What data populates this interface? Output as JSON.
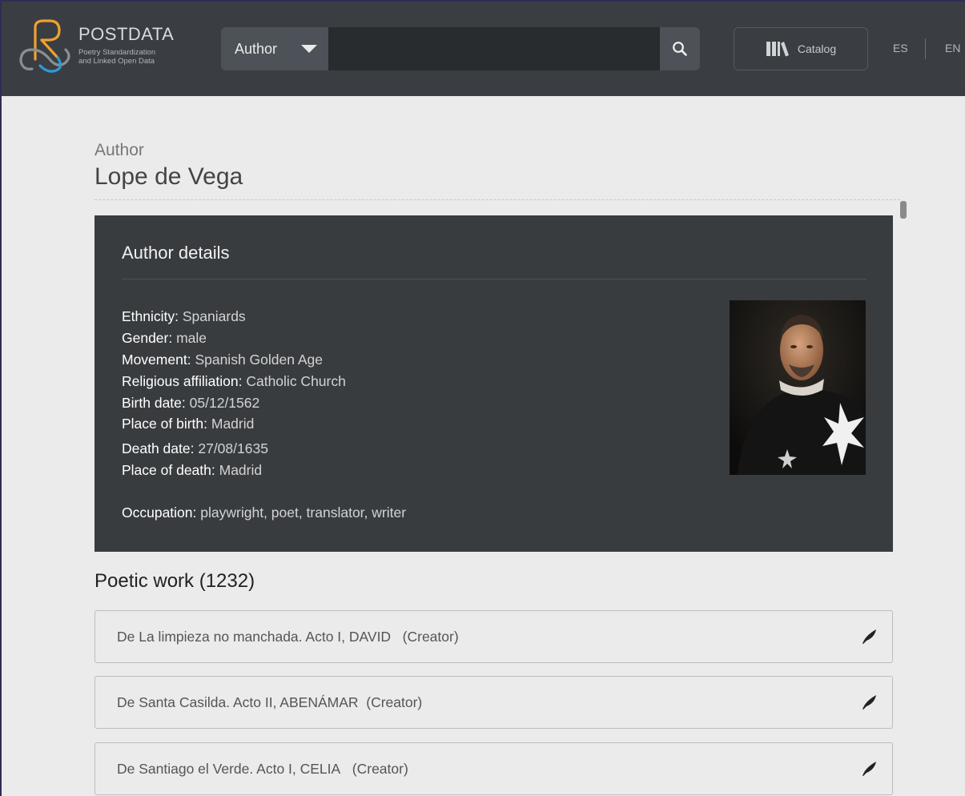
{
  "brand": {
    "name": "POSTDATA",
    "subtitle_line1": "Poetry Standardization",
    "subtitle_line2": "and Linked Open Data",
    "colors": {
      "orange": "#f0a030",
      "blue": "#2e9ad6",
      "header_bg": "#3a3e42"
    }
  },
  "search": {
    "type_selected": "Author",
    "value": "",
    "button_icon": "search-icon"
  },
  "nav": {
    "catalog_label": "Catalog",
    "catalog_icon": "library-books-icon",
    "languages": [
      "ES",
      "EN"
    ]
  },
  "page": {
    "section_label": "Author",
    "title": "Lope de Vega"
  },
  "details": {
    "heading": "Author details",
    "fields": [
      {
        "label": "Ethnicity:",
        "value": "Spaniards"
      },
      {
        "label": "Gender:",
        "value": "male"
      },
      {
        "label": "Movement:",
        "value": "Spanish Golden Age"
      },
      {
        "label": "Religious affiliation:",
        "value": "Catholic Church"
      },
      {
        "label": "Birth date:",
        "value": "05/12/1562"
      },
      {
        "label": "Place of birth:",
        "value": "Madrid"
      },
      {
        "label": "Death date:",
        "value": "27/08/1635"
      },
      {
        "label": "Place of death:",
        "value": "Madrid"
      },
      {
        "label": "Occupation:",
        "value": "playwright, poet, translator, writer"
      }
    ],
    "portrait_icon": "author-portrait-image"
  },
  "works": {
    "heading": "Poetic work (1232)",
    "items": [
      {
        "title": "De La limpieza no manchada. Acto I, DAVID   (Creator)",
        "icon": "quill-icon"
      },
      {
        "title": "De Santa Casilda. Acto II, ABENÁMAR  (Creator)",
        "icon": "quill-icon"
      },
      {
        "title": "De Santiago el Verde. Acto I, CELIA   (Creator)",
        "icon": "quill-icon"
      }
    ]
  }
}
